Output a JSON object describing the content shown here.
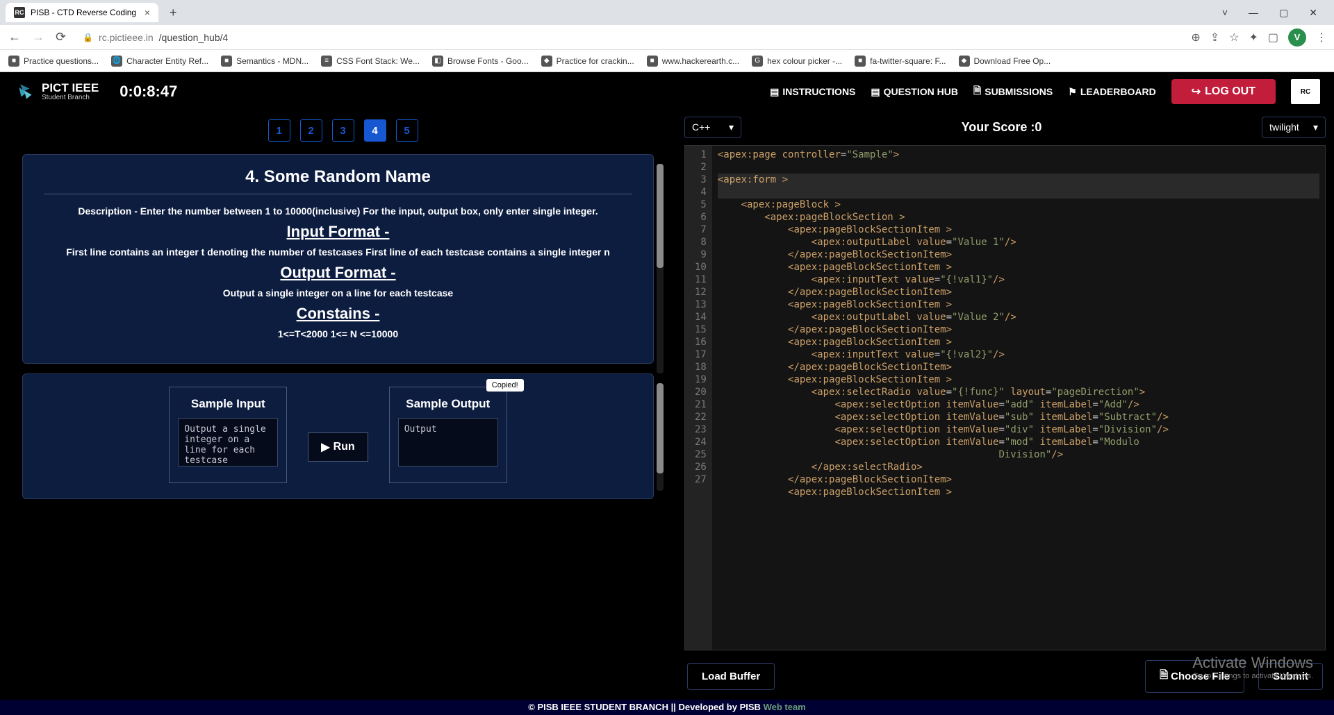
{
  "browser": {
    "tab_title": "PISB - CTD Reverse Coding",
    "tab_favicon": "RC",
    "url_host": "rc.pictieee.in",
    "url_path": "/question_hub/4",
    "avatar_initial": "V",
    "bookmarks": [
      "Practice questions...",
      "Character Entity Ref...",
      "Semantics - MDN...",
      "CSS Font Stack: We...",
      "Browse Fonts - Goo...",
      "Practice for crackin...",
      "www.hackerearth.c...",
      "hex colour picker -...",
      "fa-twitter-square: F...",
      "Download Free Op..."
    ]
  },
  "header": {
    "logo_main": "PICT IEEE",
    "logo_sub": "Student Branch",
    "timer": "0:0:8:47",
    "nav_instructions": "INSTRUCTIONS",
    "nav_question_hub": "QUESTION HUB",
    "nav_submissions": "SUBMISSIONS",
    "nav_leaderboard": "LEADERBOARD",
    "logout": "LOG OUT",
    "rc_badge": "RC"
  },
  "questions": {
    "nav": [
      "1",
      "2",
      "3",
      "4",
      "5"
    ],
    "active": "4",
    "title": "4. Some Random Name",
    "description": "Description - Enter the number between 1 to 10000(inclusive) For the input, output box, only enter single integer.",
    "input_format_label": "Input Format",
    "input_format_text": "First line contains an integer t denoting the number of testcases First line of each testcase contains a single integer n",
    "output_format_label": "Output Format",
    "output_format_text": "Output a single integer on a line for each testcase",
    "constraints_label": "Constains",
    "constraints_text": "1<=T<2000 1<= N <=10000",
    "dash": " -"
  },
  "sample": {
    "input_label": "Sample Input",
    "input_text": "Output a single integer on a line for each testcase",
    "run_label": "Run",
    "output_label": "Sample Output",
    "output_text": "Output",
    "copied_badge": "Copied!"
  },
  "editor": {
    "lang": "C++",
    "score_label": "Your Score :0",
    "theme": "twilight",
    "load_buffer": "Load Buffer",
    "choose_file": "Choose File",
    "submit": "Submit",
    "gutter": [
      "1",
      "2",
      "3",
      "4",
      "5",
      "6",
      "7",
      "8",
      "9",
      "10",
      "11",
      "12",
      "13",
      "14",
      "15",
      "16",
      "17",
      "18",
      "19",
      "20",
      "21",
      "22",
      "23",
      "24",
      "25",
      "26",
      "27"
    ],
    "code_lines": [
      [
        [
          "t",
          "<apex:page"
        ],
        [
          "p",
          " "
        ],
        [
          "a",
          "controller"
        ],
        [
          "p",
          "="
        ],
        [
          "s",
          "\"Sample\""
        ],
        [
          "t",
          ">"
        ]
      ],
      [],
      [
        [
          "t",
          "<apex:form"
        ],
        [
          "p",
          " "
        ],
        [
          "t",
          ">"
        ]
      ],
      [],
      [
        [
          "p",
          "    "
        ],
        [
          "t",
          "<apex:pageBlock"
        ],
        [
          "p",
          " "
        ],
        [
          "t",
          ">"
        ]
      ],
      [
        [
          "p",
          "        "
        ],
        [
          "t",
          "<apex:pageBlockSection"
        ],
        [
          "p",
          " "
        ],
        [
          "t",
          ">"
        ]
      ],
      [
        [
          "p",
          "            "
        ],
        [
          "t",
          "<apex:pageBlockSectionItem"
        ],
        [
          "p",
          " "
        ],
        [
          "t",
          ">"
        ]
      ],
      [
        [
          "p",
          "                "
        ],
        [
          "t",
          "<apex:outputLabel"
        ],
        [
          "p",
          " "
        ],
        [
          "a",
          "value"
        ],
        [
          "p",
          "="
        ],
        [
          "s",
          "\"Value 1\""
        ],
        [
          "t",
          "/>"
        ]
      ],
      [
        [
          "p",
          "            "
        ],
        [
          "t",
          "</apex:pageBlockSectionItem>"
        ]
      ],
      [
        [
          "p",
          "            "
        ],
        [
          "t",
          "<apex:pageBlockSectionItem"
        ],
        [
          "p",
          " "
        ],
        [
          "t",
          ">"
        ]
      ],
      [
        [
          "p",
          "                "
        ],
        [
          "t",
          "<apex:inputText"
        ],
        [
          "p",
          " "
        ],
        [
          "a",
          "value"
        ],
        [
          "p",
          "="
        ],
        [
          "s",
          "\"{!val1}\""
        ],
        [
          "t",
          "/>"
        ]
      ],
      [
        [
          "p",
          "            "
        ],
        [
          "t",
          "</apex:pageBlockSectionItem>"
        ]
      ],
      [
        [
          "p",
          "            "
        ],
        [
          "t",
          "<apex:pageBlockSectionItem"
        ],
        [
          "p",
          " "
        ],
        [
          "t",
          ">"
        ]
      ],
      [
        [
          "p",
          "                "
        ],
        [
          "t",
          "<apex:outputLabel"
        ],
        [
          "p",
          " "
        ],
        [
          "a",
          "value"
        ],
        [
          "p",
          "="
        ],
        [
          "s",
          "\"Value 2\""
        ],
        [
          "t",
          "/>"
        ]
      ],
      [
        [
          "p",
          "            "
        ],
        [
          "t",
          "</apex:pageBlockSectionItem>"
        ]
      ],
      [
        [
          "p",
          "            "
        ],
        [
          "t",
          "<apex:pageBlockSectionItem"
        ],
        [
          "p",
          " "
        ],
        [
          "t",
          ">"
        ]
      ],
      [
        [
          "p",
          "                "
        ],
        [
          "t",
          "<apex:inputText"
        ],
        [
          "p",
          " "
        ],
        [
          "a",
          "value"
        ],
        [
          "p",
          "="
        ],
        [
          "s",
          "\"{!val2}\""
        ],
        [
          "t",
          "/>"
        ]
      ],
      [
        [
          "p",
          "            "
        ],
        [
          "t",
          "</apex:pageBlockSectionItem>"
        ]
      ],
      [
        [
          "p",
          "            "
        ],
        [
          "t",
          "<apex:pageBlockSectionItem"
        ],
        [
          "p",
          " "
        ],
        [
          "t",
          ">"
        ]
      ],
      [
        [
          "p",
          "                "
        ],
        [
          "t",
          "<apex:selectRadio"
        ],
        [
          "p",
          " "
        ],
        [
          "a",
          "value"
        ],
        [
          "p",
          "="
        ],
        [
          "s",
          "\"{!func}\""
        ],
        [
          "p",
          " "
        ],
        [
          "a",
          "layout"
        ],
        [
          "p",
          "="
        ],
        [
          "s",
          "\"pageDirection\""
        ],
        [
          "t",
          ">"
        ]
      ],
      [
        [
          "p",
          "                    "
        ],
        [
          "t",
          "<apex:selectOption"
        ],
        [
          "p",
          " "
        ],
        [
          "a",
          "itemValue"
        ],
        [
          "p",
          "="
        ],
        [
          "s",
          "\"add\""
        ],
        [
          "p",
          " "
        ],
        [
          "a",
          "itemLabel"
        ],
        [
          "p",
          "="
        ],
        [
          "s",
          "\"Add\""
        ],
        [
          "t",
          "/>"
        ]
      ],
      [
        [
          "p",
          "                    "
        ],
        [
          "t",
          "<apex:selectOption"
        ],
        [
          "p",
          " "
        ],
        [
          "a",
          "itemValue"
        ],
        [
          "p",
          "="
        ],
        [
          "s",
          "\"sub\""
        ],
        [
          "p",
          " "
        ],
        [
          "a",
          "itemLabel"
        ],
        [
          "p",
          "="
        ],
        [
          "s",
          "\"Subtract\""
        ],
        [
          "t",
          "/>"
        ]
      ],
      [
        [
          "p",
          "                    "
        ],
        [
          "t",
          "<apex:selectOption"
        ],
        [
          "p",
          " "
        ],
        [
          "a",
          "itemValue"
        ],
        [
          "p",
          "="
        ],
        [
          "s",
          "\"div\""
        ],
        [
          "p",
          " "
        ],
        [
          "a",
          "itemLabel"
        ],
        [
          "p",
          "="
        ],
        [
          "s",
          "\"Division\""
        ],
        [
          "t",
          "/>"
        ]
      ],
      [
        [
          "p",
          "                    "
        ],
        [
          "t",
          "<apex:selectOption"
        ],
        [
          "p",
          " "
        ],
        [
          "a",
          "itemValue"
        ],
        [
          "p",
          "="
        ],
        [
          "s",
          "\"mod\""
        ],
        [
          "p",
          " "
        ],
        [
          "a",
          "itemLabel"
        ],
        [
          "p",
          "="
        ],
        [
          "s",
          "\"Modulo "
        ]
      ],
      [
        [
          "p",
          "                                                "
        ],
        [
          "s",
          "Division\""
        ],
        [
          "t",
          "/>"
        ]
      ],
      [
        [
          "p",
          "                "
        ],
        [
          "t",
          "</apex:selectRadio>"
        ]
      ],
      [
        [
          "p",
          "            "
        ],
        [
          "t",
          "</apex:pageBlockSectionItem>"
        ]
      ],
      [
        [
          "p",
          "            "
        ],
        [
          "t",
          "<apex:pageBlockSectionItem"
        ],
        [
          "p",
          " "
        ],
        [
          "t",
          ">"
        ]
      ]
    ]
  },
  "watermark": {
    "line1": "Activate Windows",
    "line2": "Go to Settings to activate Windows."
  },
  "footer": {
    "text_prefix": "© PISB IEEE STUDENT BRANCH || Developed by PISB ",
    "link": "Web team"
  }
}
